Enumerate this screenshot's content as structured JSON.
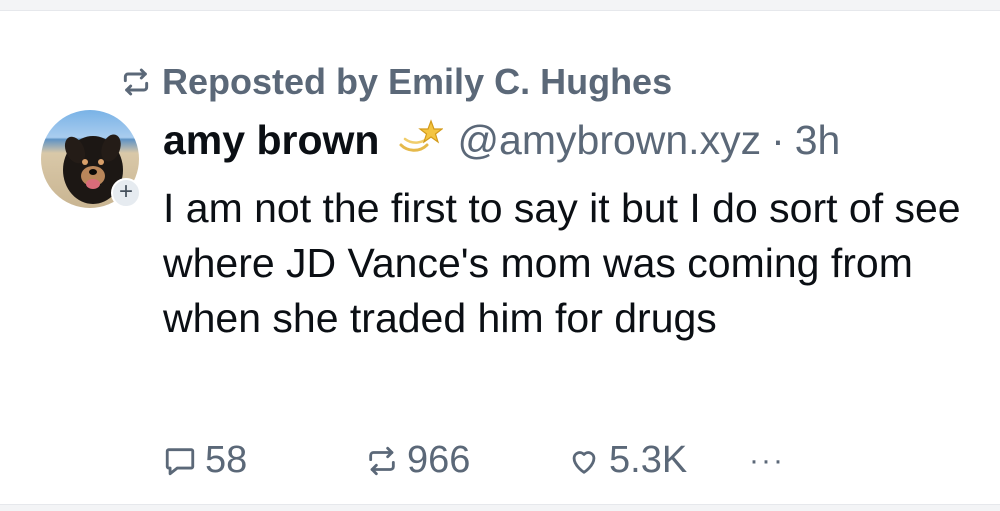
{
  "repost_label": "Reposted by Emily C. Hughes",
  "author": {
    "name": "amy brown",
    "handle": "@amybrown.xyz",
    "separator": "·",
    "time": "3h"
  },
  "post": {
    "text": "I am not the first to say it but I do sort of see where JD Vance's mom was coming from when she traded him for drugs"
  },
  "actions": {
    "replies": "58",
    "reposts": "966",
    "likes": "5.3K",
    "more": "···"
  },
  "follow_badge": "+",
  "icons": {
    "repost_header": "repost-icon",
    "verified": "dizzy-star-icon",
    "reply": "speech-bubble-icon",
    "repost": "repost-icon",
    "like": "heart-icon",
    "more": "ellipsis-icon"
  },
  "colors": {
    "text": "#0b0f14",
    "muted": "#5b6878",
    "background": "#ffffff"
  }
}
